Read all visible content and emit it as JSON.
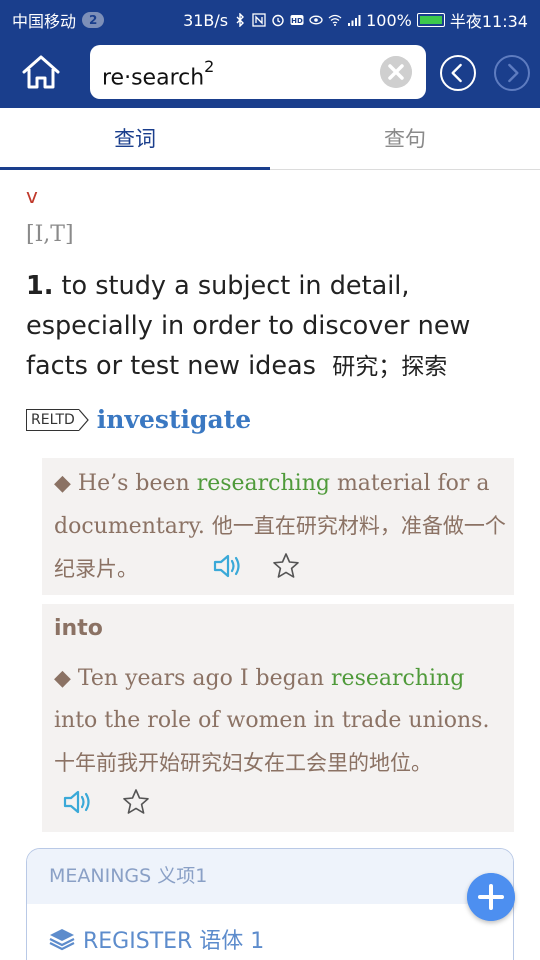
{
  "status_bar": {
    "carrier": "中国移动",
    "sim_badge": "2",
    "net_speed": "31B/s",
    "battery": "100%",
    "time": "半夜11:34"
  },
  "app_bar": {
    "search_word": "re·search",
    "search_superscript": "2"
  },
  "tabs": [
    {
      "label": "查词",
      "active": true
    },
    {
      "label": "查句",
      "active": false
    }
  ],
  "entry": {
    "pos": "v",
    "grammar": "[I,T]",
    "sense_number": "1.",
    "definition_en": "to study a subject in detail, especially in order to discover new facts or test new ideas",
    "definition_cn": "研究；探索",
    "related_tag": "RELTD",
    "related_word": "investigate"
  },
  "examples": [
    {
      "collocation": "",
      "bullet": "◆",
      "before": "He’s been ",
      "highlight": "researching",
      "after": " material for a documentary.",
      "translation": "他一直在研究材料，准备做一个纪录片。"
    },
    {
      "collocation": "into",
      "bullet": "◆",
      "before": "Ten years ago I began ",
      "highlight": "researching",
      "after": " into the role of women in trade unions.",
      "translation": "十年前我开始研究妇女在工会里的地位。"
    }
  ],
  "meanings": {
    "header": "MEANINGS 义项1",
    "register": "REGISTER 语体 1"
  },
  "colors": {
    "primary": "#1a3e8c",
    "highlight": "#4f9a3a",
    "example_text": "#8b7264",
    "related_word": "#3a78c2",
    "pos": "#c0392b",
    "fab": "#4d8ff0"
  }
}
